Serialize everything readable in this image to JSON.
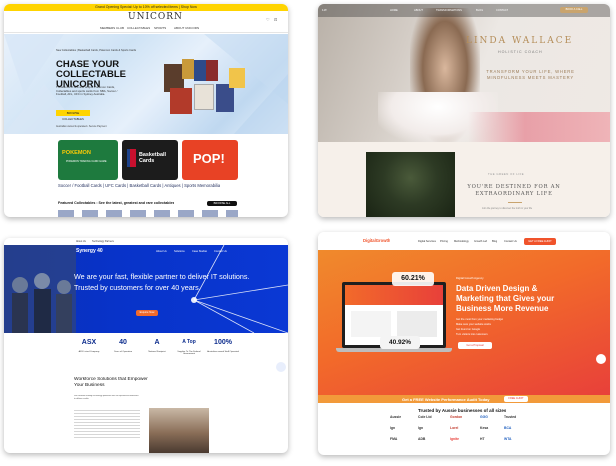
{
  "card1": {
    "banner": "Grand Opening Special: Up to 10% off selected items | Shop Now",
    "logo": "UNICORN",
    "nav": [
      "MEMBERS CLUB",
      "COLLECTABLES",
      "SPORTS",
      "ABOUT UNICORN"
    ],
    "kicker": "New Collectables | Basketball Cards, Pokemon Cards & Sports Cards",
    "headline": "CHASE YOUR COLLECTABLE UNICORN",
    "body": "Thousands of rare and unique Pokemon Cards, Collectables and sports cards from NBA, Soccer / Football, AFL, UFC in Sydney Australia.",
    "button": "BROWSE COLLECTABLES",
    "trust_text": "Australian owned & operated • Secure Payment",
    "categories": [
      "POKEMON TRADING CARD GAME",
      "Basketball Cards",
      "POP!"
    ],
    "category_links": "Soccer / Football Cards | UFC Cards | Basketball Cards | Antiques | Sports Memorabilia",
    "featured_title": "Featured Collectables : See the latest, greatest and rare collectables",
    "featured_button": "BROWSE ALL FEATURED"
  },
  "card2": {
    "nav": [
      "HOME",
      "ABOUT",
      "TRANSFORMATIONS",
      "BLOG",
      "CONTACT"
    ],
    "cta": "BOOK A CALL",
    "name": "LINDA WALLACE",
    "subtitle": "HOLISTIC COACH",
    "tagline": "TRANSFORM YOUR LIFE, WHERE MINDFULNESS MEETS MASTERY",
    "kicker": "THE GREEN OF LIFE",
    "destined": "YOU'RE DESTINED FOR AN EXTRAORDINARY LIFE",
    "para": "Join the journey to discover the truth in your life"
  },
  "card3": {
    "top_links": [
      "About Us",
      "Technology Partners"
    ],
    "logo": "Synergy 40",
    "nav": [
      "About Us",
      "Solutions",
      "Case Studies",
      "Contact Us"
    ],
    "headline": "We are your fast, flexible partner to deliver IT solutions. Trusted by customers for over 40 years.",
    "button": "Enquire Now",
    "stats": [
      {
        "value": "ASX",
        "label": "ASX Listed Company"
      },
      {
        "value": "40",
        "label": "Years of Operation"
      },
      {
        "value": "A",
        "label": "National Footprint"
      },
      {
        "value": "A Top",
        "label": "Supplier To The Federal Government"
      },
      {
        "value": "100%",
        "label": "Australian owned Staff Operated"
      }
    ],
    "section_title": "Workforce Solutions that Empower Your Business",
    "para": "We combine leading technology platforms with an experienced workforce to deliver results."
  },
  "card4": {
    "logo": "DigitalGrowth",
    "nav": [
      "Digital Services",
      "Pricing",
      "Methodology",
      "Growth Lab",
      "Blog",
      "Contact Us"
    ],
    "nav_cta": "GET A FREE AUDIT",
    "badge_top": "60.21%",
    "badge_bottom": "40.92%",
    "label": "Digital Growth Agency",
    "headline": "Data Driven Design & Marketing that Gives your Business More Revenue",
    "bullets": [
      "Get the most from your marketing budget",
      "Make sure your website works",
      "Get found on Google",
      "Turn visitors into customers"
    ],
    "button": "Get a Proposal",
    "strip": "Get a FREE Website Performance Audit Today",
    "strip_cta": "FREE AUDIT",
    "trusted": "Trusted by Aussie businesses of all sizes",
    "logos": [
      "Aussie",
      "Cole Ltd",
      "Gordon",
      "GGG",
      "Trusted",
      "lgn",
      "lgn",
      "Lorel",
      "Kesa",
      "BCA",
      "FMA",
      "ADB",
      "lmcar",
      "Ignite",
      "HT",
      "WTA"
    ]
  },
  "colors": {
    "unicorn_yellow": "#ffd400",
    "synergy_blue": "#0833c9",
    "growth_orange": "#f26a2a",
    "coach_gold": "#b58e5a"
  }
}
